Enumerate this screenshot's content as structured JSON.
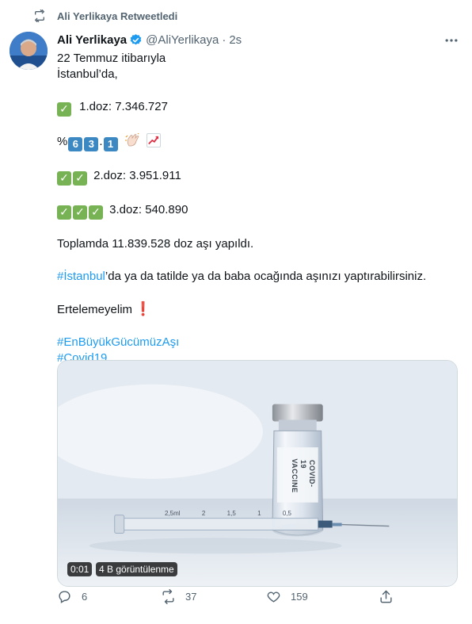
{
  "retweet": {
    "label": "Ali Yerlikaya Retweetledi"
  },
  "author": {
    "name": "Ali Yerlikaya",
    "handle": "@AliYerlikaya",
    "separator": "·",
    "time": "2s"
  },
  "tweet": {
    "line1": "22 Temmuz itibarıyla",
    "line2": "İstanbul’da,",
    "dose1": "1.doz: 7.346.727",
    "percent_sign": "%",
    "percent_digits": [
      "6",
      "3",
      "1"
    ],
    "percent_dot": ".",
    "dose2": "2.doz: 3.951.911",
    "dose3": "3.doz: 540.890",
    "total": "Toplamda 11.839.528 doz aşı yapıldı.",
    "istanbul_tag": "#İstanbul",
    "istanbul_rest": "’da ya da tatilde ya da baba ocağında aşınızı yaptırabilirsiniz.",
    "postpone": "Ertelemeyelim",
    "hashtag1": "#EnBüyükGücümüzAşı",
    "hashtag2": "#Covid19"
  },
  "media": {
    "video_time": "0:01",
    "views": "4 B görüntülenme",
    "vial_label_line1": "COVID-19",
    "vial_label_line2": "VACCINE",
    "syringe_marks": [
      "2,5ml",
      "2",
      "1,5",
      "1",
      "0,5"
    ]
  },
  "actions": {
    "replies": "6",
    "retweets": "37",
    "likes": "159"
  },
  "colors": {
    "link": "#1d9bf0",
    "muted": "#536471",
    "check_green": "#77b255",
    "keycap_blue": "#3b88c3"
  }
}
